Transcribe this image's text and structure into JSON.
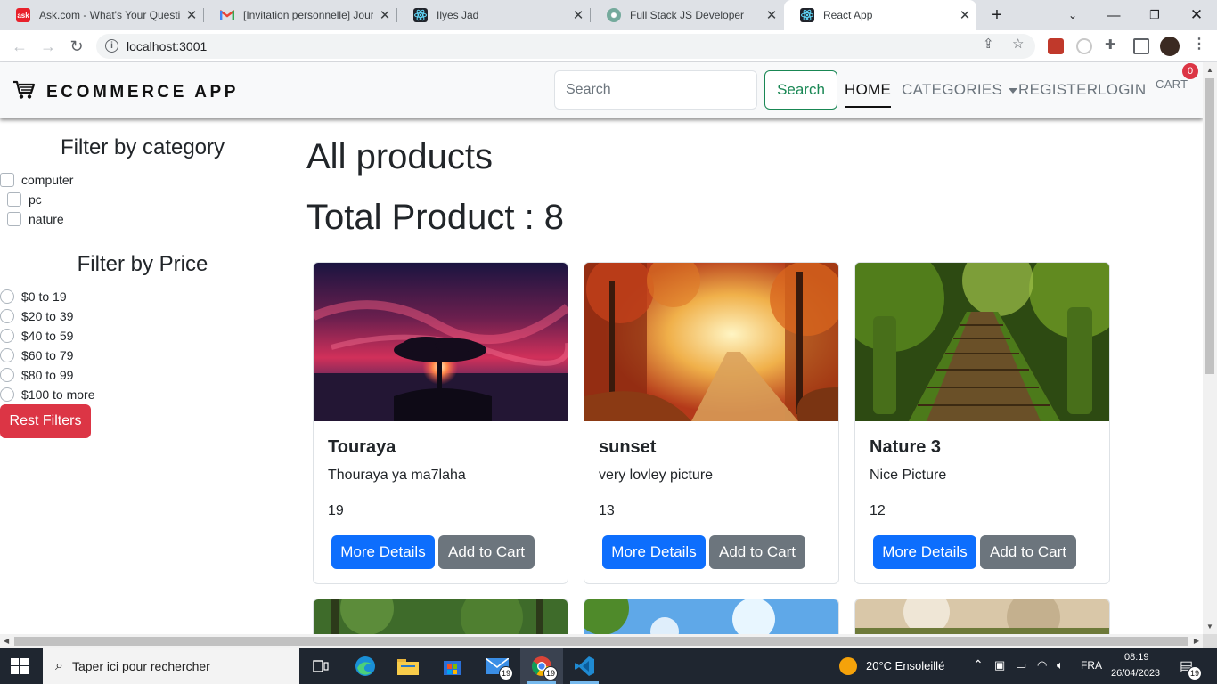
{
  "browser": {
    "tabs": [
      {
        "title": "Ask.com - What's Your Question?",
        "icon": "ask-icon"
      },
      {
        "title": "[Invitation personnelle] Journée",
        "icon": "gmail-icon"
      },
      {
        "title": "Ilyes Jad",
        "icon": "react-icon"
      },
      {
        "title": "Full Stack JS Developer",
        "icon": "openai-icon"
      },
      {
        "title": "React App",
        "icon": "react-icon"
      }
    ],
    "url": "localhost:3001"
  },
  "app": {
    "brand": "ECOMMERCE APP",
    "search_placeholder": "Search",
    "search_button": "Search",
    "nav": {
      "home": "HOME",
      "categories": "CATEGORIES",
      "register": "REGISTER",
      "login": "LOGIN",
      "cart": "CART",
      "cart_count": "0"
    }
  },
  "sidebar": {
    "category_title": "Filter by category",
    "categories": [
      "computer",
      "pc",
      "nature"
    ],
    "price_title": "Filter by Price",
    "prices": [
      "$0 to 19",
      "$20 to 39",
      "$40 to 59",
      "$60 to 79",
      "$80 to 99",
      "$100 to more"
    ],
    "reset_button": "Rest Filters"
  },
  "main": {
    "heading": "All products",
    "total": "Total Product : 8",
    "details_label": "More Details",
    "cart_label": "Add to Cart",
    "products": [
      {
        "name": "Touraya",
        "description": "Thouraya ya ma7laha",
        "price": "19"
      },
      {
        "name": "sunset",
        "description": "very lovley picture",
        "price": "13"
      },
      {
        "name": "Nature 3",
        "description": "Nice Picture",
        "price": "12"
      }
    ]
  },
  "taskbar": {
    "search_placeholder": "Taper ici pour rechercher",
    "mail_count": "19",
    "chrome_count": "19",
    "weather": "20°C  Ensoleillé",
    "language": "FRA",
    "time": "08:19",
    "date": "26/04/2023",
    "notifications": "19"
  },
  "colors": {
    "primary": "#0d6efd",
    "secondary": "#6c757d",
    "danger": "#dc3545",
    "success": "#198754"
  }
}
